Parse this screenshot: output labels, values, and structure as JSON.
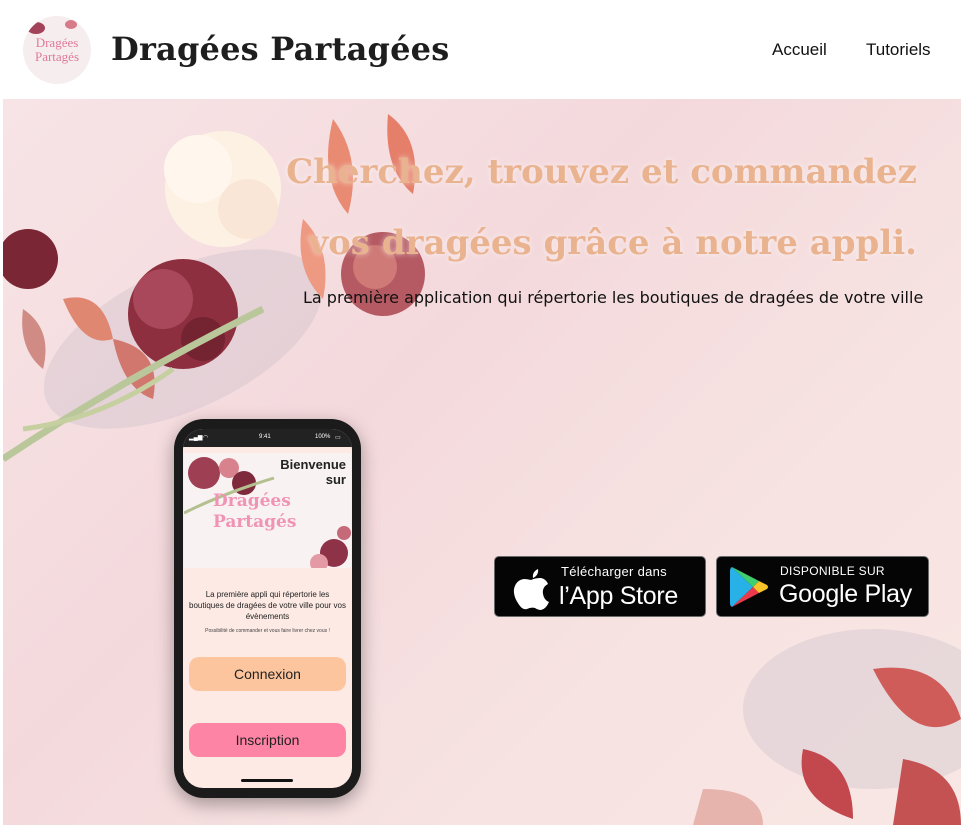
{
  "header": {
    "logo_line1": "Dragées",
    "logo_line2": "Partagés",
    "brand": "Dragées Partagées",
    "nav": [
      "Accueil",
      "Tutoriels"
    ]
  },
  "hero": {
    "headline_line1": "Cherchez, trouvez et commandez",
    "headline_line2": "vos dragées grâce à notre appli.",
    "subline": "La première application qui répertorie les boutiques de dragées de votre ville"
  },
  "phone": {
    "status_time": "9:41",
    "status_battery": "100%",
    "welcome_line1": "Bienvenue",
    "welcome_line2": "sur",
    "title_line1": "Dragées",
    "title_line2": "Partagés",
    "description": "La première appli qui répertorie les boutiques de dragées de votre ville pour vos évènements",
    "small_note": "Possibilité de commander et vous faire livrer chez vous !",
    "login_label": "Connexion",
    "signup_label": "Inscription"
  },
  "badges": {
    "appstore_small": "Télécharger dans",
    "appstore_big": "l’App Store",
    "googleplay_small": "DISPONIBLE SUR",
    "googleplay_big": "Google Play"
  },
  "colors": {
    "headline": "#eab390",
    "login_button": "#fdc59d",
    "signup_button": "#fd84a4",
    "phone_title": "#f093b5"
  },
  "icons": [
    "apple-icon",
    "google-play-icon",
    "wifi-icon",
    "signal-icon",
    "battery-icon"
  ]
}
